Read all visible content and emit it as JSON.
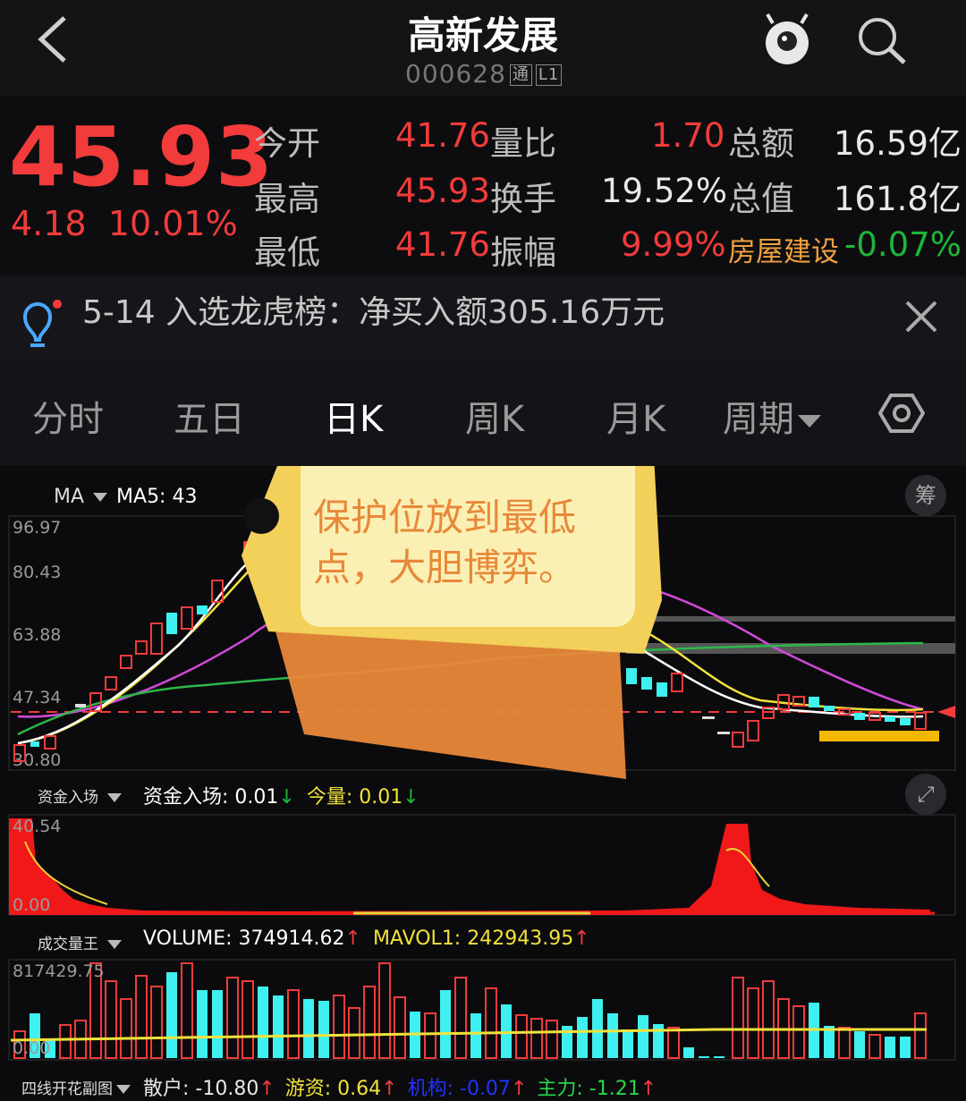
{
  "header": {
    "title": "高新发展",
    "code": "000628",
    "tag1": "通",
    "tag2": "L1"
  },
  "quote": {
    "price": "45.93",
    "change": "4.18",
    "change_pct": "10.01%",
    "cells": [
      {
        "label": "今开",
        "value": "41.76"
      },
      {
        "label": "量比",
        "value": "1.70"
      },
      {
        "label": "总额",
        "value": "16.59亿"
      },
      {
        "label": "最高",
        "value": "45.93"
      },
      {
        "label": "换手",
        "value": "19.52%"
      },
      {
        "label": "总值",
        "value": "161.8亿"
      },
      {
        "label": "最低",
        "value": "41.76"
      },
      {
        "label": "振幅",
        "value": "9.99%"
      },
      {
        "label": "房屋建设",
        "value": "-0.07%"
      }
    ]
  },
  "notice": {
    "text": "5-14 入选龙虎榜：净买入额305.16万元"
  },
  "tabs": [
    "分时",
    "五日",
    "日K",
    "周K",
    "月K",
    "周期"
  ],
  "sticker": {
    "text_line1": "保护位放到最低",
    "text_line2": "点，大胆博弈。"
  },
  "main_chart": {
    "indicator": "MA",
    "ma5_label": "MA5: 43",
    "chip_btn": "筹",
    "y_ticks": [
      "96.97",
      "80.43",
      "63.88",
      "47.34",
      "30.80"
    ]
  },
  "fund_chart": {
    "name": "资金入场",
    "v1_label": "资金入场: ",
    "v1": "0.01",
    "v1_arrow": "↓",
    "v2_label": "今量: ",
    "v2": "0.01",
    "v2_arrow": "↓",
    "y_top": "40.54",
    "y_bottom": "0.00"
  },
  "volume_chart": {
    "name": "成交量王",
    "v1_label": "VOLUME: ",
    "v1": "374914.62",
    "v1_arrow": "↑",
    "v2_label": "MAVOL1: ",
    "v2": "242943.95",
    "v2_arrow": "↑",
    "y_top": "817429.75",
    "y_bottom": "0.00"
  },
  "bottom_indicator": {
    "name": "四线开花副图",
    "items": [
      {
        "label": "散户: ",
        "value": "-10.80",
        "arrow": "↑",
        "color": "#e8e8e8"
      },
      {
        "label": "游资: ",
        "value": "0.64",
        "arrow": "↑",
        "color": "#f2e23a"
      },
      {
        "label": "机构: ",
        "value": "-0.07",
        "arrow": "↑",
        "color": "#2233ff"
      },
      {
        "label": "主力: ",
        "value": "-1.21",
        "arrow": "↑",
        "color": "#2bd64a"
      }
    ]
  },
  "colors": {
    "up": "#f23b3b",
    "down": "#3ff0f0",
    "ma5": "#ffffff",
    "ma10": "#f2e23a",
    "ma20": "#d04ad8",
    "ma60": "#2bb84a",
    "accent": "#f5a623"
  }
}
